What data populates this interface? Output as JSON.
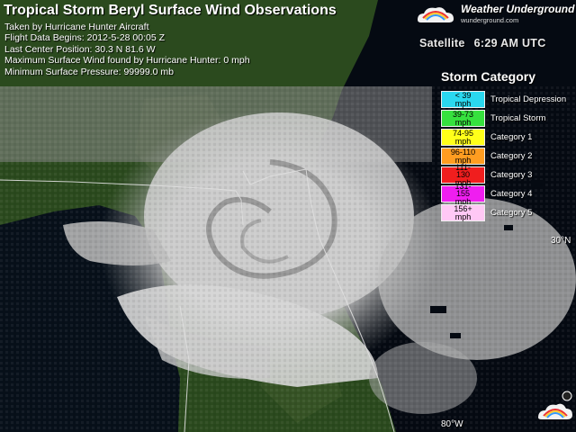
{
  "title": "Tropical Storm Beryl Surface Wind Observations",
  "info": [
    "Taken by Hurricane Hunter Aircraft",
    "Flight Data Begins: 2012-5-28 00:05 Z",
    "Last Center Position: 30.3 N 81.6 W",
    "Maximum Surface Wind found by Hurricane Hunter: 0 mph",
    "Minimum Surface Pressure: 99999.0 mb"
  ],
  "logo": {
    "name": "Weather Underground",
    "sub": "wunderground.com",
    "icon": "rainbow-cloud-icon"
  },
  "satellite": {
    "label": "Satellite",
    "time": "6:29 AM UTC"
  },
  "legend": {
    "title": "Storm Category",
    "items": [
      {
        "range": "< 39 mph",
        "label": "Tropical Depression",
        "color": "#2ad8ef"
      },
      {
        "range": "39-73 mph",
        "label": "Tropical Storm",
        "color": "#36e13e"
      },
      {
        "range": "74-95 mph",
        "label": "Category 1",
        "color": "#ffff1a"
      },
      {
        "range": "96-110 mph",
        "label": "Category 2",
        "color": "#ff9d21"
      },
      {
        "range": "111-130 mph",
        "label": "Category 3",
        "color": "#f01e1e"
      },
      {
        "range": "131-155 mph",
        "label": "Category 4",
        "color": "#ef1ef0"
      },
      {
        "range": "156+ mph",
        "label": "Category 5",
        "color": "#ffc8f5"
      }
    ]
  },
  "coords": {
    "lat": "30°N",
    "lon": "80°W"
  },
  "colors": {
    "land": "#2b4a1e",
    "land_light": "#3e5a2c",
    "water": "#050a12",
    "cloud": "#c9c9c9",
    "border": "#e0e0e0"
  }
}
